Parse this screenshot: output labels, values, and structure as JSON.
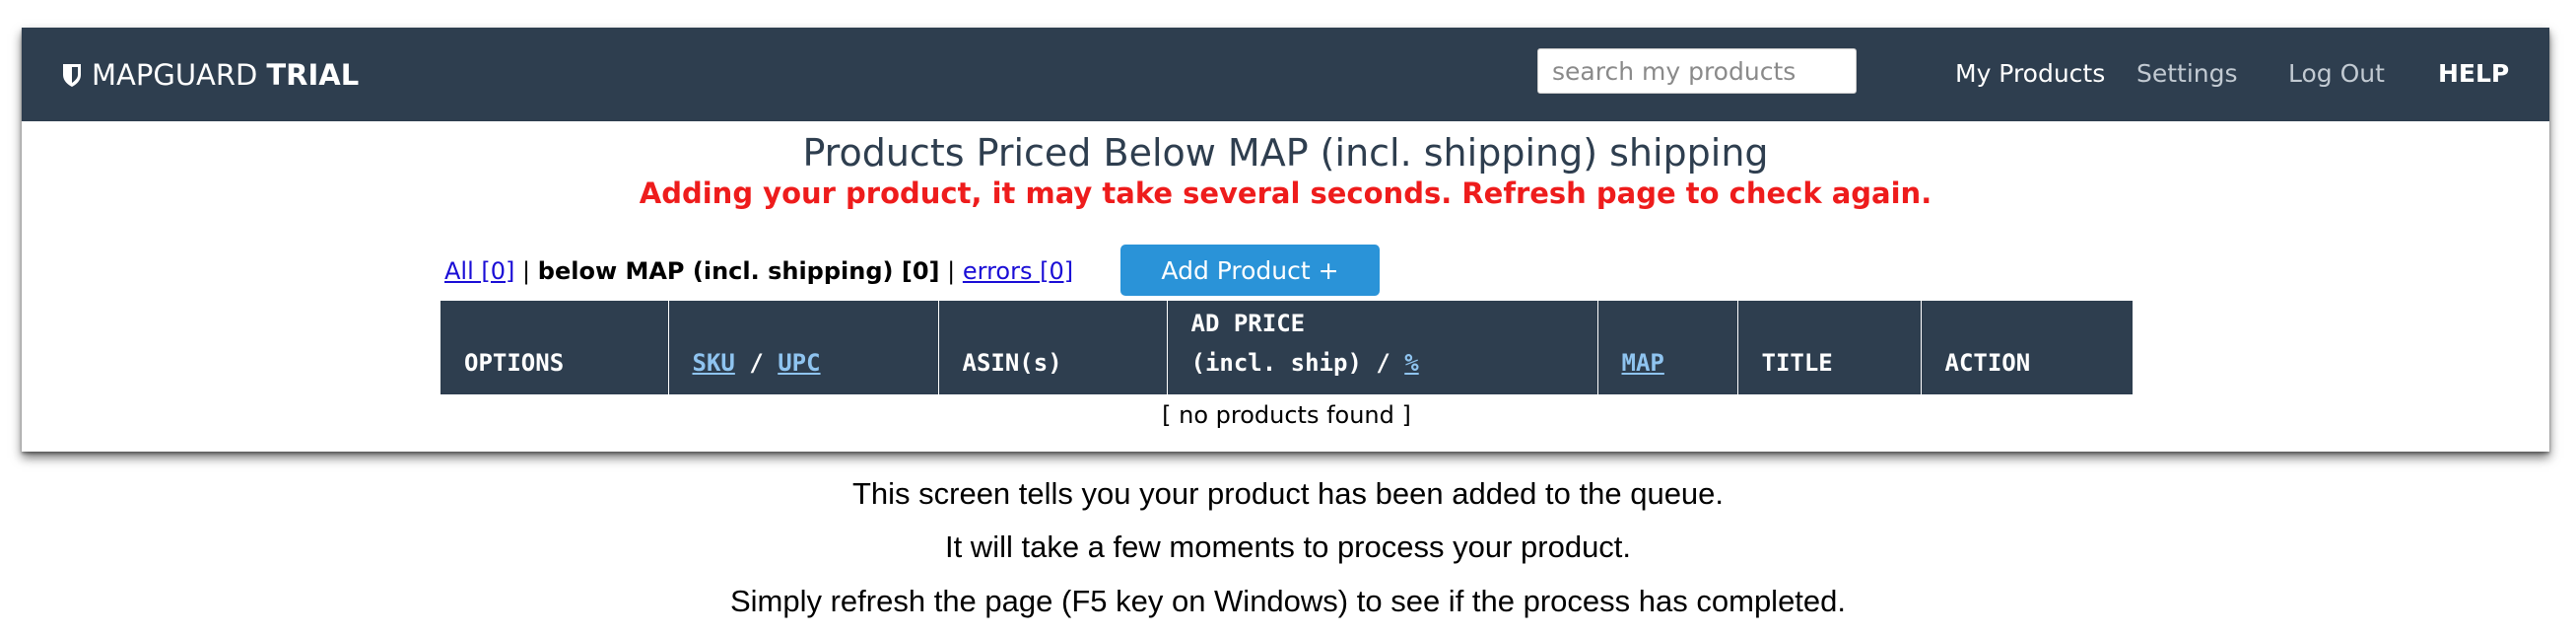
{
  "app": {
    "brand_name": "MAPGUARD",
    "brand_suffix": "TRIAL"
  },
  "nav": {
    "search_placeholder": "search my products",
    "links": [
      {
        "label": "My Products"
      },
      {
        "label": "Settings"
      },
      {
        "label": "Log Out"
      },
      {
        "label": "HELP"
      }
    ]
  },
  "main": {
    "title": "Products Priced Below MAP (incl. shipping) shipping",
    "alert": "Adding your product, it may take several seconds. Refresh page to check again.",
    "filters": {
      "all": "All [0]",
      "below": "below MAP (incl. shipping) [0]",
      "errors": "errors [0]",
      "separator": "|"
    },
    "add_button": "Add Product +",
    "table": {
      "headers": {
        "options": "OPTIONS",
        "sku": "SKU",
        "slash": "/",
        "upc": "UPC",
        "asins": "ASIN(s)",
        "ad_price_line1": "AD PRICE",
        "ad_price_line2": "(incl. ship) /",
        "percent": "%",
        "map": "MAP",
        "title": "TITLE",
        "action": "ACTION"
      },
      "empty_message": "[ no products found ]"
    }
  },
  "captions": [
    "This screen tells you your product has been added to the queue.",
    "It will take a few moments to process your product.",
    "Simply refresh the page (F5 key on Windows) to see if the process has completed."
  ],
  "colors": {
    "navbar": "#2e3e4f",
    "accent_button": "#2a93d8",
    "alert_text": "#ee1c1c",
    "link": "#1a0dd6"
  }
}
